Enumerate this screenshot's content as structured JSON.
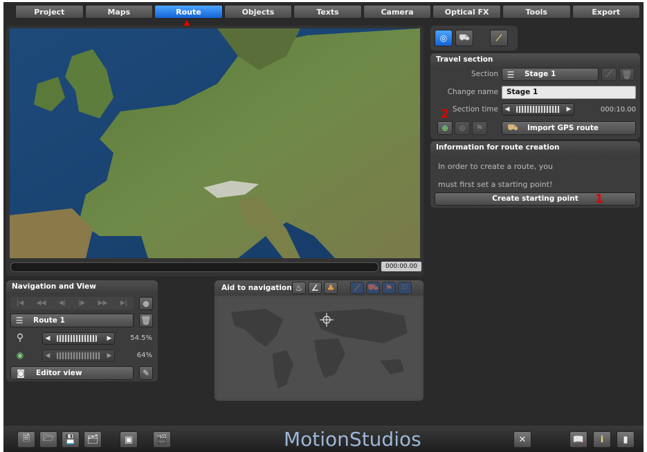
{
  "tabs": [
    "Project",
    "Maps",
    "Route",
    "Objects",
    "Texts",
    "Camera",
    "Optical FX",
    "Tools",
    "Export"
  ],
  "active_tab": "Route",
  "preview": {
    "timecode": "000:00.00"
  },
  "travel_section": {
    "title": "Travel section",
    "section_label": "Section",
    "section_value": "Stage 1",
    "change_name_label": "Change name",
    "change_name_value": "Stage 1",
    "section_time_label": "Section time",
    "section_time_value": "000:10.00",
    "import_gps_label": "Import GPS route"
  },
  "info": {
    "title": "Information for route creation",
    "line1": "In order to create a route, you",
    "line2": "must first set a starting point!",
    "create_button": "Create starting point"
  },
  "annotations": {
    "mark1": "1",
    "mark2": "2"
  },
  "nav_view": {
    "title": "Navigation and View",
    "route_name": "Route 1",
    "zoom_value": "54.5%",
    "second_value": "64%",
    "editor_view": "Editor view"
  },
  "aid_nav": {
    "title": "Aid to navigation"
  },
  "brand": "MotionStudios",
  "colors": {
    "accent": "#1e7bf0",
    "panel": "#3c3c3c",
    "annotation": "#e00000"
  }
}
